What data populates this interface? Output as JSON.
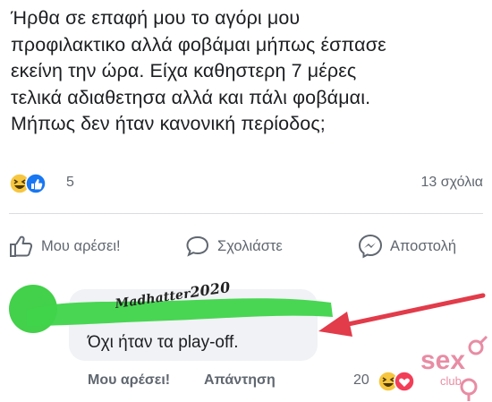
{
  "post": {
    "text": "Ήρθα σε επαφή μου το αγόρι μου\nπροφιλακτικο αλλά φοβάμαι μήπως έσπασε\nεκείνη την ώρα. Είχα καθηστερη 7 μέρες\nτελικά αδιαθετησα αλλά και πάλι φοβάμαι.\nΜήπως δεν ήταν κανονική περίοδος;"
  },
  "reactions": {
    "icons": [
      "haha-icon",
      "like-icon"
    ],
    "count": "5",
    "comments_label": "13 σχόλια"
  },
  "actions": {
    "like_label": "Μου αρέσει!",
    "comment_label": "Σχολιάστε",
    "share_label": "Αποστολή"
  },
  "comment": {
    "overlay_handle": "Madhatter",
    "overlay_year": "2020",
    "text": "Όχι ήταν τα play-off.",
    "like_label": "Μου αρέσει!",
    "reply_label": "Απάντηση",
    "reaction_count": "20",
    "reaction_icons": [
      "haha-icon",
      "love-icon"
    ]
  },
  "watermark": {
    "text": "sex club"
  },
  "colors": {
    "text": "#1c1e21",
    "muted": "#606770",
    "scribble_green": "#3fd44a",
    "arrow_red": "#e23b4a",
    "like_blue": "#1877f2",
    "haha_yellow": "#f7c640",
    "love_red": "#f33e58"
  }
}
